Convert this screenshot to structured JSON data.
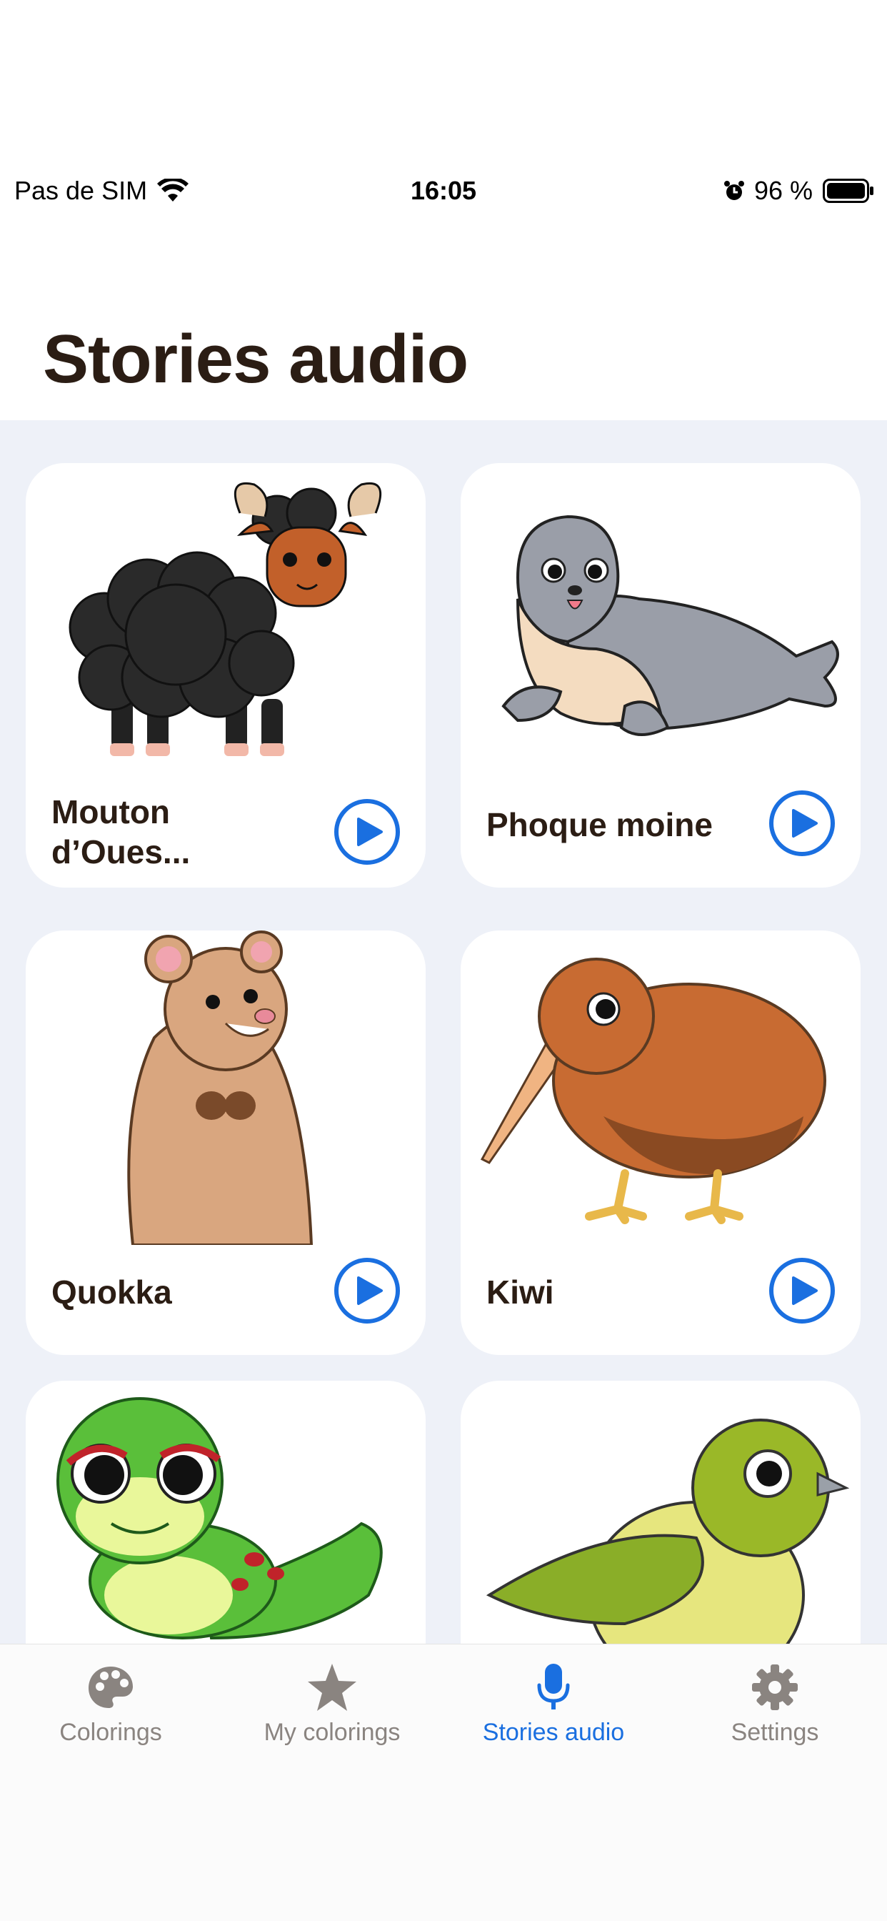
{
  "status_bar": {
    "carrier": "Pas de SIM",
    "time": "16:05",
    "battery_percent": "96 %",
    "icons": [
      "wifi-icon",
      "alarm-icon",
      "battery-icon"
    ]
  },
  "header": {
    "title": "Stories audio"
  },
  "stories": [
    {
      "title": "Mouton d’Oues...",
      "title_line1": "Mouton",
      "title_line2": "d’Oues...",
      "image": "black-sheep-illustration"
    },
    {
      "title": "Phoque moine",
      "image": "monk-seal-illustration"
    },
    {
      "title": "Quokka",
      "image": "quokka-illustration"
    },
    {
      "title": "Kiwi",
      "image": "kiwi-bird-illustration"
    },
    {
      "title": "",
      "image": "gecko-illustration"
    },
    {
      "title": "",
      "image": "green-bird-illustration"
    }
  ],
  "tab_bar": {
    "items": [
      {
        "label": "Colorings",
        "icon": "palette-icon",
        "active": false
      },
      {
        "label": "My colorings",
        "icon": "star-icon",
        "active": false
      },
      {
        "label": "Stories audio",
        "icon": "microphone-icon",
        "active": true
      },
      {
        "label": "Settings",
        "icon": "gear-icon",
        "active": false
      }
    ]
  },
  "colors": {
    "accent": "#1a6fe0",
    "background": "#eef1f8",
    "text": "#2b1d14",
    "inactive": "#8a8480"
  }
}
